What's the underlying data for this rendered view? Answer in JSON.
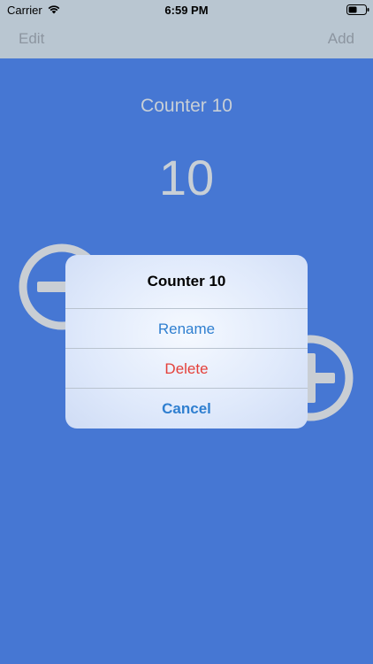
{
  "status_bar": {
    "carrier": "Carrier",
    "time": "6:59 PM",
    "wifi_icon": "wifi-icon",
    "battery_icon": "battery-icon"
  },
  "nav": {
    "edit_label": "Edit",
    "add_label": "Add"
  },
  "counter": {
    "title": "Counter 10",
    "value": "10"
  },
  "controls": {
    "decrement_icon": "minus-circle-icon",
    "increment_icon": "plus-circle-icon"
  },
  "alert": {
    "title": "Counter 10",
    "actions": [
      {
        "label": "Rename"
      },
      {
        "label": "Delete"
      },
      {
        "label": "Cancel"
      }
    ]
  },
  "colors": {
    "background": "#4677d3",
    "nav_bar": "#b9c6d1",
    "text_muted": "#c8cfd6",
    "action_blue": "#2f7fd0",
    "destructive_red": "#e4403a"
  }
}
